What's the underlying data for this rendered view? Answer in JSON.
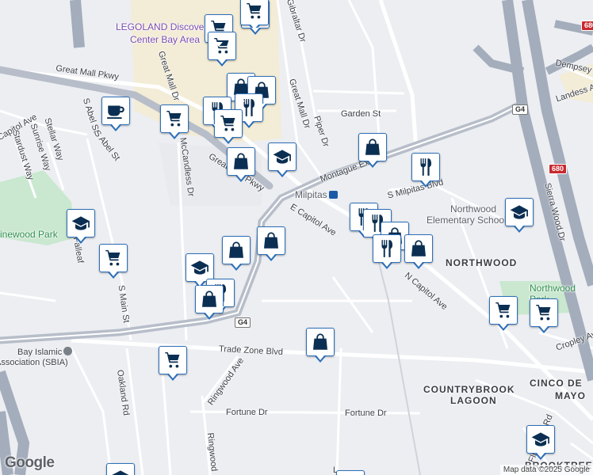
{
  "map": {
    "attribution": "Map data ©2025 Google",
    "logo": "Google",
    "colors": {
      "land": "#eceef2",
      "road": "#ffffff",
      "highway": "#a9b2c0",
      "park": "#c9e8cf",
      "commercial": "#f3ecd6",
      "marker_border": "#2d6fb8",
      "marker_icon": "#0b2f52"
    }
  },
  "labels": {
    "legoland": "LEGOLAND Discovery",
    "legoland2": "Center Bay Area",
    "great_mall_pkwy_top": "Great Mall Pkwy",
    "great_mall_pkwy_mid": "Great Mall Pkwy",
    "great_mall_dr_left": "Great Mall Dr",
    "great_mall_dr_right": "Great Mall Dr",
    "gibraltar": "Gibraltar Dr",
    "piper": "Piper Dr",
    "garden": "Garden St",
    "montague_expy_top": "Montague Expy",
    "montague_expy_bottom": "Montague Expy",
    "milpitas": "Milpitas",
    "s_milpitas": "S Milpitas Blvd",
    "e_capitol": "E Capitol Ave",
    "n_capitol": "N Capitol Ave",
    "northwood_elem1": "Northwood",
    "northwood_elem2": "Elementary School",
    "northwood_district": "NORTHWOOD",
    "northwood_park1": "Northwood",
    "northwood_park2": "Park",
    "sierra_wood": "Sierra Wood Dr",
    "dempsey": "Dempsey Rd",
    "landess": "Landess Ave",
    "cropley": "Cropley Ave",
    "cinco": "CINCO DE",
    "mayo": "MAYO",
    "countrybrook1": "COUNTRYBROOK",
    "countrybrook2": "LAGOON",
    "trade_zone": "Trade Zone Blvd",
    "ringwood_ave": "Ringwood Ave",
    "ringwood_ct": "Ringwood",
    "fortune_dr_left": "Fortune Dr",
    "fortune_dr_right": "Fortune Dr",
    "oakland_rd": "Oakland Rd",
    "s_main": "S Main St",
    "mccandless": "McCandless Dr",
    "s_abel": "S Abel St",
    "s_abel2": "S Abel St",
    "capitol_ave": "Capitol Ave",
    "sunrise": "Sunrise Way",
    "stellar": "Stellar Way",
    "stardust": "Stardust Way",
    "pinewood_park": "Pinewood Park",
    "fallen": "Falleaf",
    "islamic1": "Bay Islamic",
    "islamic2": "Association (SBIA)",
    "flickinger": "Flickinger Rd",
    "brook": "BROOKTREE",
    "hwy680_a": "680",
    "hwy680_b": "680",
    "g4_a": "G4",
    "g4_b": "G4",
    "l_frag": "L"
  },
  "markers": [
    {
      "id": "m1",
      "icon": "shopping-cart-icon"
    },
    {
      "id": "m2",
      "icon": "shopping-cart-icon"
    },
    {
      "id": "m3",
      "icon": "shopping-cart-icon"
    },
    {
      "id": "m4",
      "icon": "shopping-cart-icon"
    },
    {
      "id": "m5",
      "icon": "shopping-bag-icon"
    },
    {
      "id": "m6",
      "icon": "shopping-bag-icon"
    },
    {
      "id": "m7",
      "icon": "restaurant-icon"
    },
    {
      "id": "m8",
      "icon": "restaurant-icon"
    },
    {
      "id": "m9",
      "icon": "shopping-cart-icon"
    },
    {
      "id": "m10",
      "icon": "coffee-icon"
    },
    {
      "id": "m11",
      "icon": "shopping-cart-icon"
    },
    {
      "id": "m12",
      "icon": "shopping-bag-icon"
    },
    {
      "id": "m13",
      "icon": "school-icon"
    },
    {
      "id": "m14",
      "icon": "shopping-bag-icon"
    },
    {
      "id": "m15",
      "icon": "restaurant-icon"
    },
    {
      "id": "m16",
      "icon": "restaurant-icon"
    },
    {
      "id": "m17",
      "icon": "restaurant-icon"
    },
    {
      "id": "m18",
      "icon": "shopping-bag-icon"
    },
    {
      "id": "m19",
      "icon": "restaurant-icon"
    },
    {
      "id": "m20",
      "icon": "shopping-bag-icon"
    },
    {
      "id": "m21",
      "icon": "school-icon"
    },
    {
      "id": "m22",
      "icon": "school-icon"
    },
    {
      "id": "m23",
      "icon": "shopping-cart-icon"
    },
    {
      "id": "m24",
      "icon": "shopping-bag-icon"
    },
    {
      "id": "m25",
      "icon": "shopping-bag-icon"
    },
    {
      "id": "m26",
      "icon": "school-icon"
    },
    {
      "id": "m27",
      "icon": "restaurant-icon"
    },
    {
      "id": "m28",
      "icon": "shopping-bag-icon"
    },
    {
      "id": "m29",
      "icon": "shopping-cart-icon"
    },
    {
      "id": "m30",
      "icon": "shopping-cart-icon"
    },
    {
      "id": "m31",
      "icon": "shopping-cart-icon"
    },
    {
      "id": "m32",
      "icon": "shopping-bag-icon"
    },
    {
      "id": "m33",
      "icon": "school-icon"
    },
    {
      "id": "m34",
      "icon": "school-icon"
    },
    {
      "id": "m35",
      "icon": "shopping-cart-icon"
    }
  ]
}
